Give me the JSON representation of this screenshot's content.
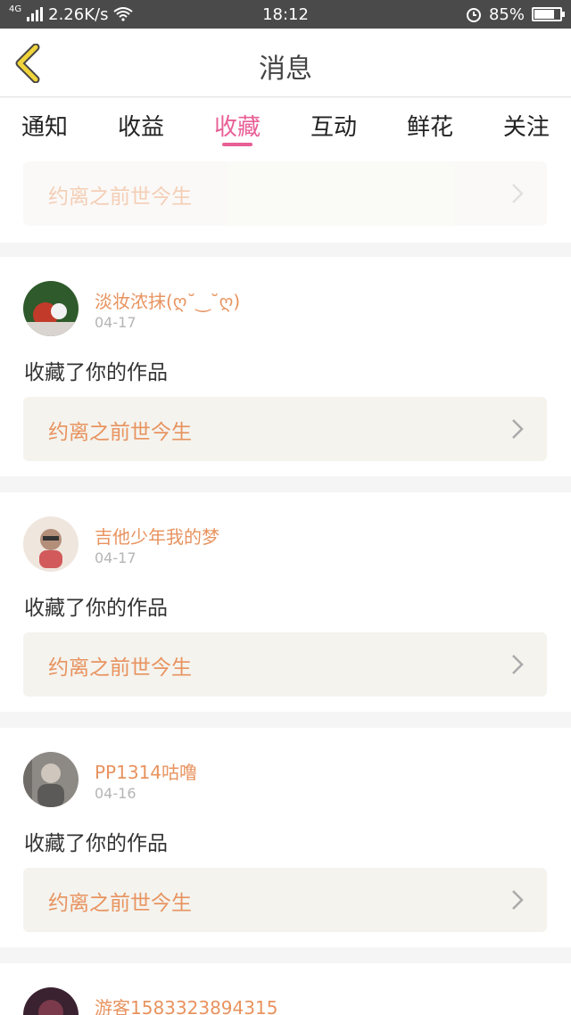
{
  "status_bar": {
    "network_type": "4G",
    "speed": "2.26K/s",
    "time": "18:12",
    "battery": "85%",
    "battery_level": 0.85
  },
  "header": {
    "title": "消息"
  },
  "tabs": [
    {
      "label": "通知",
      "active": false
    },
    {
      "label": "收益",
      "active": false
    },
    {
      "label": "收藏",
      "active": true
    },
    {
      "label": "互动",
      "active": false
    },
    {
      "label": "鲜花",
      "active": false
    },
    {
      "label": "关注",
      "active": false
    }
  ],
  "partial_top": {
    "work_title": "约离之前世今生"
  },
  "feed": [
    {
      "username": "淡妆浓抹(ღ˘‿˘ღ)",
      "date": "04-17",
      "action": "收藏了你的作品",
      "work_title": "约离之前世今生",
      "avatar_colors": [
        "#2f5a2b",
        "#c23a2a"
      ]
    },
    {
      "username": "吉他少年我的梦",
      "date": "04-17",
      "action": "收藏了你的作品",
      "work_title": "约离之前世今生",
      "avatar_colors": [
        "#efe6de",
        "#b38f7a"
      ]
    },
    {
      "username": "PP1314咕噜",
      "date": "04-16",
      "action": "收藏了你的作品",
      "work_title": "约离之前世今生",
      "avatar_colors": [
        "#8d8a85",
        "#5c5a58"
      ]
    },
    {
      "username": "游客1583323894315",
      "date": "",
      "action": "",
      "work_title": "",
      "avatar_colors": [
        "#3a2230",
        "#7a3a4c"
      ]
    }
  ],
  "colors": {
    "accent": "#e85f96",
    "name": "#e8935f",
    "back": "#f0d43a"
  }
}
